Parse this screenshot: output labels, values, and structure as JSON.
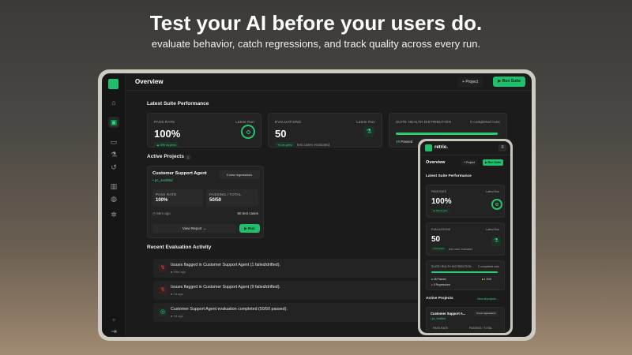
{
  "hero": {
    "title": "Test your AI before your users do.",
    "subtitle": "evaluate behavior, catch regressions, and track quality across every run."
  },
  "colors": {
    "accent": "#1fbf6b",
    "surface": "#1b1b1b",
    "card": "#232323",
    "danger": "#e0453a"
  },
  "tablet": {
    "page_title": "Overview",
    "project_button": "+ Project",
    "run_suite_button": "▶ Run Suite",
    "latest_suite_title": "Latest Suite Performance",
    "pass_rate": {
      "label": "PASS RATE",
      "tag": "Latest Run",
      "value": "100%",
      "delta": "▲ 0% vs prev"
    },
    "evaluations": {
      "label": "EVALUATIONS",
      "tag": "Latest Run",
      "value": "50",
      "delta": "+0 vs prev",
      "note": "test cases evaluated"
    },
    "health": {
      "label": "SUITE HEALTH DISTRIBUTION",
      "tag": "0 completed runs",
      "passed_count": "48",
      "passed_label": "Passed",
      "fill": 0.96
    },
    "active_projects_title": "Active Projects",
    "active_projects_count": "1",
    "project": {
      "name": "Customer Support Agent",
      "sub": "• pc_4vctl9uf",
      "badge": "0 new regressions",
      "pass_rate_label": "PASS RATE",
      "pass_rate_value": "100%",
      "passing_label": "PASSING / TOTAL",
      "passing_value": "50/50",
      "age": "59m ago",
      "cases": "50 test cases",
      "view_button": "View Report →",
      "run_button": "▶ Run"
    },
    "recent_title": "Recent Evaluation Activity",
    "activity": [
      {
        "text": "Issues flagged in Customer Support Agent (1 failed/drifted).",
        "time": "● 59m ago",
        "status": "flagged"
      },
      {
        "text": "Issues flagged in Customer Support Agent (9 failed/drifted).",
        "time": "● 1d ago",
        "status": "flagged"
      },
      {
        "text": "Customer Support Agent evaluation completed (50/50 passed).",
        "time": "● 1d ago",
        "status": "completed"
      }
    ]
  },
  "phone": {
    "brand": "retrio.",
    "page_title": "Overview",
    "project_button": "+ Project",
    "run_suite_button": "▶ Run Suite",
    "latest_suite_title": "Latest Suite Performance",
    "pass_rate": {
      "label": "PASS RATE",
      "tag": "Latest Run",
      "value": "100%",
      "delta": "▲ 0% vs prev"
    },
    "evaluations": {
      "label": "EVALUATIONS",
      "tag": "Latest Run",
      "value": "50",
      "delta": "+0 vs prev",
      "note": "test cases evaluated"
    },
    "health": {
      "label": "SUITE HEALTH DISTRIBUTION",
      "tag": "0 completed runs",
      "passed": "48 Passed",
      "regressions": "0 Regressions",
      "drift": "1 Drift",
      "fill": 0.96
    },
    "active_projects_title": "Active Projects",
    "view_all": "View all projects →",
    "project": {
      "name": "Customer Support A...",
      "sub": "• pc_4vctl9uf",
      "badge": "0 new regressions",
      "col1": "PASS RATE",
      "col2": "PASSING / TOTAL"
    }
  }
}
